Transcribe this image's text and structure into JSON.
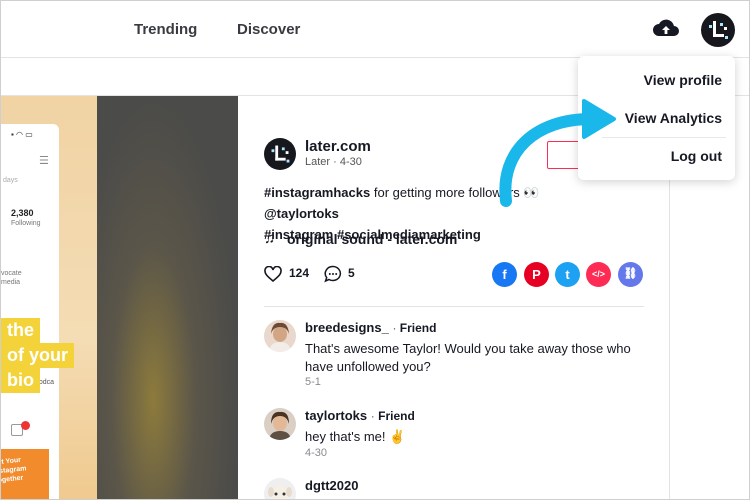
{
  "nav": {
    "trending": "Trending",
    "discover": "Discover",
    "upload_icon": "cloud-upload-icon",
    "avatar_icon": "later-logo-icon"
  },
  "dropdown": {
    "items": [
      "View profile",
      "View Analytics",
      "Log out"
    ]
  },
  "video_preview": {
    "stat_number": "2,380",
    "stat_label": "Following",
    "days_text": "days",
    "bio_text": "vocate\nmedia",
    "tag_lines": [
      "the",
      "of your",
      "bio"
    ],
    "side_label": "podca",
    "card_text": "Get Your\nInstagram\nTogether"
  },
  "post": {
    "author": "later.com",
    "author_sub": "Later · 4-30",
    "caption_hashtag1": "#instagramhacks",
    "caption_mid": " for getting more followers 👀 ",
    "caption_mention": "@taylortoks",
    "caption_line2": "#instagram #socialmediamarketing",
    "sound": "original sound - later.com",
    "likes": "124",
    "comments": "5"
  },
  "comments": [
    {
      "name": "breedesigns_",
      "role": "Friend",
      "text": "That's awesome Taylor! Would you take away those who have unfollowed you?",
      "date": "5-1"
    },
    {
      "name": "taylortoks",
      "role": "Friend",
      "text": "hey that's me! ✌️",
      "date": "4-30"
    },
    {
      "name": "dgtt2020",
      "role": "",
      "text": "",
      "date": ""
    }
  ],
  "colors": {
    "accent_red": "#fe2c55",
    "arrow_blue": "#1ab7ea",
    "facebook": "#1877f2",
    "pinterest": "#e60023",
    "twitter": "#1da1f2"
  }
}
